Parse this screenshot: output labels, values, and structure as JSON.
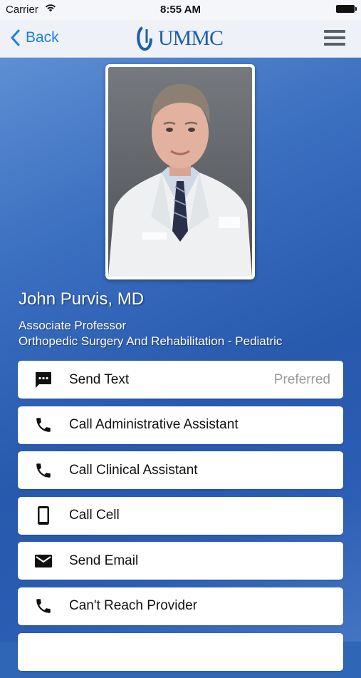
{
  "status_bar": {
    "carrier": "Carrier",
    "time": "8:55 AM"
  },
  "nav": {
    "back_label": "Back",
    "logo_text": "UMMC"
  },
  "provider": {
    "name": "John Purvis, MD",
    "title": "Associate Professor",
    "department": "Orthopedic Surgery And Rehabilitation - Pediatric"
  },
  "actions": [
    {
      "label": "Send Text",
      "badge": "Preferred",
      "icon": "message-icon"
    },
    {
      "label": "Call Administrative Assistant",
      "badge": "",
      "icon": "phone-icon"
    },
    {
      "label": "Call Clinical Assistant",
      "badge": "",
      "icon": "phone-icon"
    },
    {
      "label": "Call Cell",
      "badge": "",
      "icon": "cellphone-icon"
    },
    {
      "label": "Send Email",
      "badge": "",
      "icon": "email-icon"
    },
    {
      "label": "Can't Reach Provider",
      "badge": "",
      "icon": "phone-icon"
    }
  ],
  "colors": {
    "accent": "#1c7cf4",
    "brand": "#1f5ea8",
    "background": "#2f66b6"
  }
}
